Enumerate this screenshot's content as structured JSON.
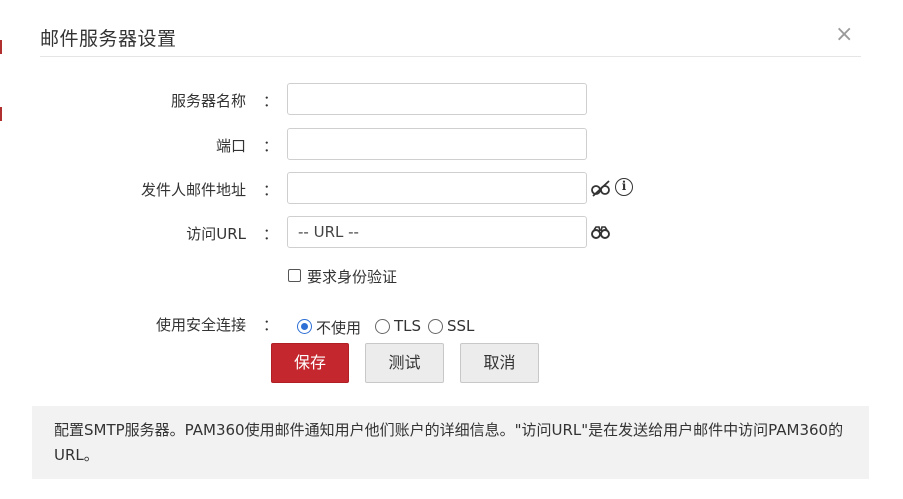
{
  "dialog": {
    "title": "邮件服务器设置",
    "close_label": "×"
  },
  "form": {
    "colon": "：",
    "server_name": {
      "label": "服务器名称",
      "value": "",
      "placeholder": ""
    },
    "port": {
      "label": "端口",
      "value": "",
      "placeholder": ""
    },
    "sender_email": {
      "label": "发件人邮件地址",
      "value": "",
      "placeholder": "",
      "icons": [
        "eye-slash-icon",
        "info-icon"
      ],
      "info_glyph": "i"
    },
    "access_url": {
      "label": "访问URL",
      "value": "",
      "placeholder": "-- URL --",
      "icons": [
        "binoculars-icon"
      ]
    },
    "require_auth": {
      "label": "要求身份验证",
      "checked": false
    },
    "secure_connection": {
      "label": "使用安全连接",
      "options": [
        {
          "label": "不使用",
          "selected": true
        },
        {
          "label": "TLS",
          "selected": false
        },
        {
          "label": "SSL",
          "selected": false
        }
      ]
    }
  },
  "buttons": {
    "save": "保存",
    "test": "测试",
    "cancel": "取消"
  },
  "note": {
    "text": "配置SMTP服务器。PAM360使用邮件通知用户他们账户的详细信息。\"访问URL\"是在发送给用户邮件中访问PAM360的URL。"
  },
  "colors": {
    "primary_button": "#c4272d",
    "radio_selected": "#2e6fd6",
    "note_background": "#f2f2f2"
  }
}
